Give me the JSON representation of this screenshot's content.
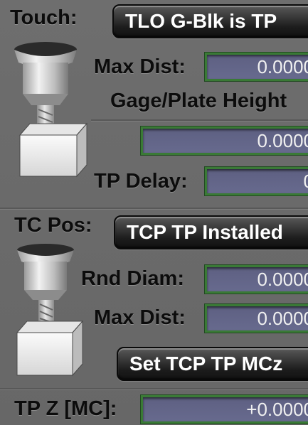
{
  "touch": {
    "label": "Touch:",
    "button": "TLO G-Blk is TP",
    "max_dist": {
      "label": "Max Dist:",
      "value": "0.0000"
    },
    "gage_height": {
      "label": "Gage/Plate Height",
      "value": "0.0000"
    },
    "tp_delay": {
      "label": "TP Delay:",
      "value": "0"
    }
  },
  "tc_pos": {
    "label": "TC Pos:",
    "button": "TCP TP Installed",
    "rnd_diam": {
      "label": "Rnd Diam:",
      "value": "0.0000"
    },
    "max_dist": {
      "label": "Max Dist:",
      "value": "0.0000"
    },
    "set_button": "Set TCP TP MCz"
  },
  "tp_z": {
    "label": "TP Z [MC]:",
    "value": "+0.0000"
  },
  "colors": {
    "field_border": "#3a7a36",
    "field_bg": "#63668a",
    "panel_bg": "#6c6c6c"
  }
}
